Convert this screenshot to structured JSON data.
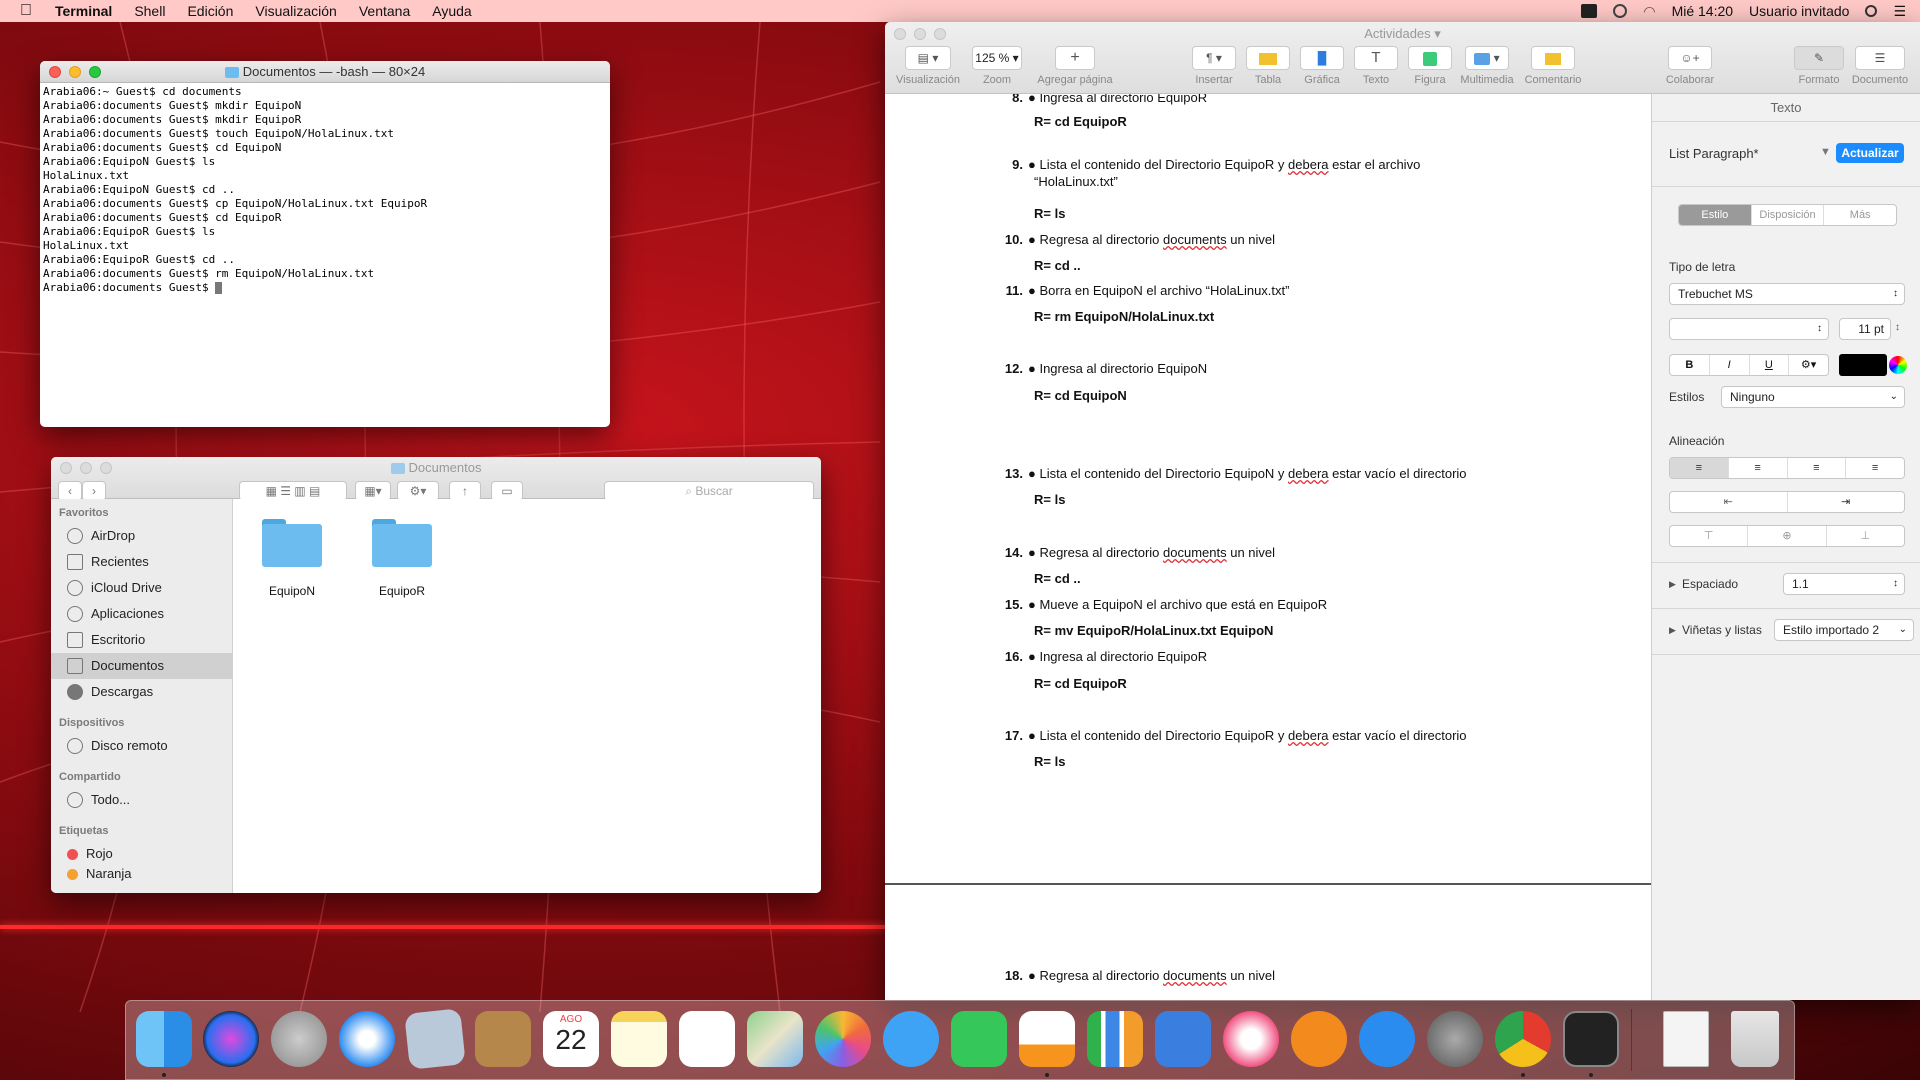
{
  "menubar": {
    "app": "Terminal",
    "items": [
      "Shell",
      "Edición",
      "Visualización",
      "Ventana",
      "Ayuda"
    ],
    "clock": "Mié 14:20",
    "user": "Usuario invitado"
  },
  "terminal": {
    "title": "Documentos — -bash — 80×24",
    "lines": [
      "Arabia06:~ Guest$ cd documents",
      "Arabia06:documents Guest$ mkdir EquipoN",
      "Arabia06:documents Guest$ mkdir EquipoR",
      "Arabia06:documents Guest$ touch EquipoN/HolaLinux.txt",
      "Arabia06:documents Guest$ cd EquipoN",
      "Arabia06:EquipoN Guest$ ls",
      "HolaLinux.txt",
      "Arabia06:EquipoN Guest$ cd ..",
      "Arabia06:documents Guest$ cp EquipoN/HolaLinux.txt EquipoR",
      "Arabia06:documents Guest$ cd EquipoR",
      "Arabia06:EquipoR Guest$ ls",
      "HolaLinux.txt",
      "Arabia06:EquipoR Guest$ cd ..",
      "Arabia06:documents Guest$ rm EquipoN/HolaLinux.txt",
      "Arabia06:documents Guest$ "
    ]
  },
  "finder": {
    "title": "Documentos",
    "search_placeholder": "Buscar",
    "favorites_header": "Favoritos",
    "favorites": [
      "AirDrop",
      "Recientes",
      "iCloud Drive",
      "Aplicaciones",
      "Escritorio",
      "Documentos",
      "Descargas"
    ],
    "devices_header": "Dispositivos",
    "devices": [
      "Disco remoto"
    ],
    "shared_header": "Compartido",
    "shared": [
      "Todo..."
    ],
    "tags_header": "Etiquetas",
    "tags": [
      "Rojo",
      "Naranja"
    ],
    "folders": [
      "EquipoN",
      "EquipoR"
    ]
  },
  "pages": {
    "window_title": "Actividades",
    "toolbar": {
      "view": "Visualización",
      "zoom_value": "125 %",
      "zoom": "Zoom",
      "add_page": "Agregar página",
      "insert": "Insertar",
      "table": "Tabla",
      "chart": "Gráfica",
      "text": "Texto",
      "shape": "Figura",
      "media": "Multimedia",
      "comment": "Comentario",
      "collaborate": "Colaborar",
      "format": "Formato",
      "document": "Documento"
    },
    "doc": {
      "i8": "● Ingresa al directorio EquipoR",
      "a8": "R= cd EquipoR",
      "i9a": "● Lista el contenido del Directorio EquipoR y ",
      "i9b": "debera",
      "i9c": " estar el archivo",
      "i9d": "“HolaLinux.txt”",
      "a9": "R= ls",
      "i10a": "● Regresa al directorio ",
      "i10b": "documents",
      "i10c": " un nivel",
      "a10": "R= cd ..",
      "i11": "● Borra en EquipoN el archivo  “HolaLinux.txt”",
      "a11": "R= rm EquipoN/HolaLinux.txt",
      "i12": "● Ingresa al directorio EquipoN",
      "a12": "R= cd EquipoN",
      "i13a": "● Lista el contenido del Directorio EquipoN y ",
      "i13b": "debera",
      "i13c": " estar vacío el directorio",
      "a13": "R= ls",
      "i14a": "● Regresa al directorio ",
      "i14b": "documents",
      "i14c": " un nivel",
      "a14": "R= cd ..",
      "i15": "● Mueve a EquipoN el archivo que está en EquipoR",
      "a15": "R= mv EquipoR/HolaLinux.txt  EquipoN",
      "i16": "● Ingresa al directorio EquipoR",
      "a16": "R= cd EquipoR",
      "i17a": "● Lista el contenido del Directorio EquipoR y ",
      "i17b": "debera",
      "i17c": " estar vacío el directorio",
      "a17": "R= ls",
      "i18a": "● Regresa al directorio ",
      "i18b": "documents",
      "i18c": " un nivel",
      "nums": [
        "8.",
        "9.",
        "10.",
        "11.",
        "12.",
        "13.",
        "14.",
        "15.",
        "16.",
        "17.",
        "18."
      ]
    },
    "inspector": {
      "header": "Texto",
      "style_name": "List Paragraph*",
      "update_button": "Actualizar",
      "tabs": [
        "Estilo",
        "Disposición",
        "Más"
      ],
      "font_label": "Tipo de letra",
      "font": "Trebuchet MS",
      "size": "11 pt",
      "styles_label": "Estilos",
      "styles_value": "Ninguno",
      "alignment_label": "Alineación",
      "spacing_label": "Espaciado",
      "spacing_value": "1.1",
      "bullets_label": "Viñetas y listas",
      "bullets_value": "Estilo importado 2"
    }
  },
  "dock": {
    "calendar_month": "AGO",
    "calendar_day": "22"
  },
  "colors": {
    "menubar": "#ffc9c7",
    "desktop": "#c8141c",
    "accent": "#1a8cff"
  }
}
